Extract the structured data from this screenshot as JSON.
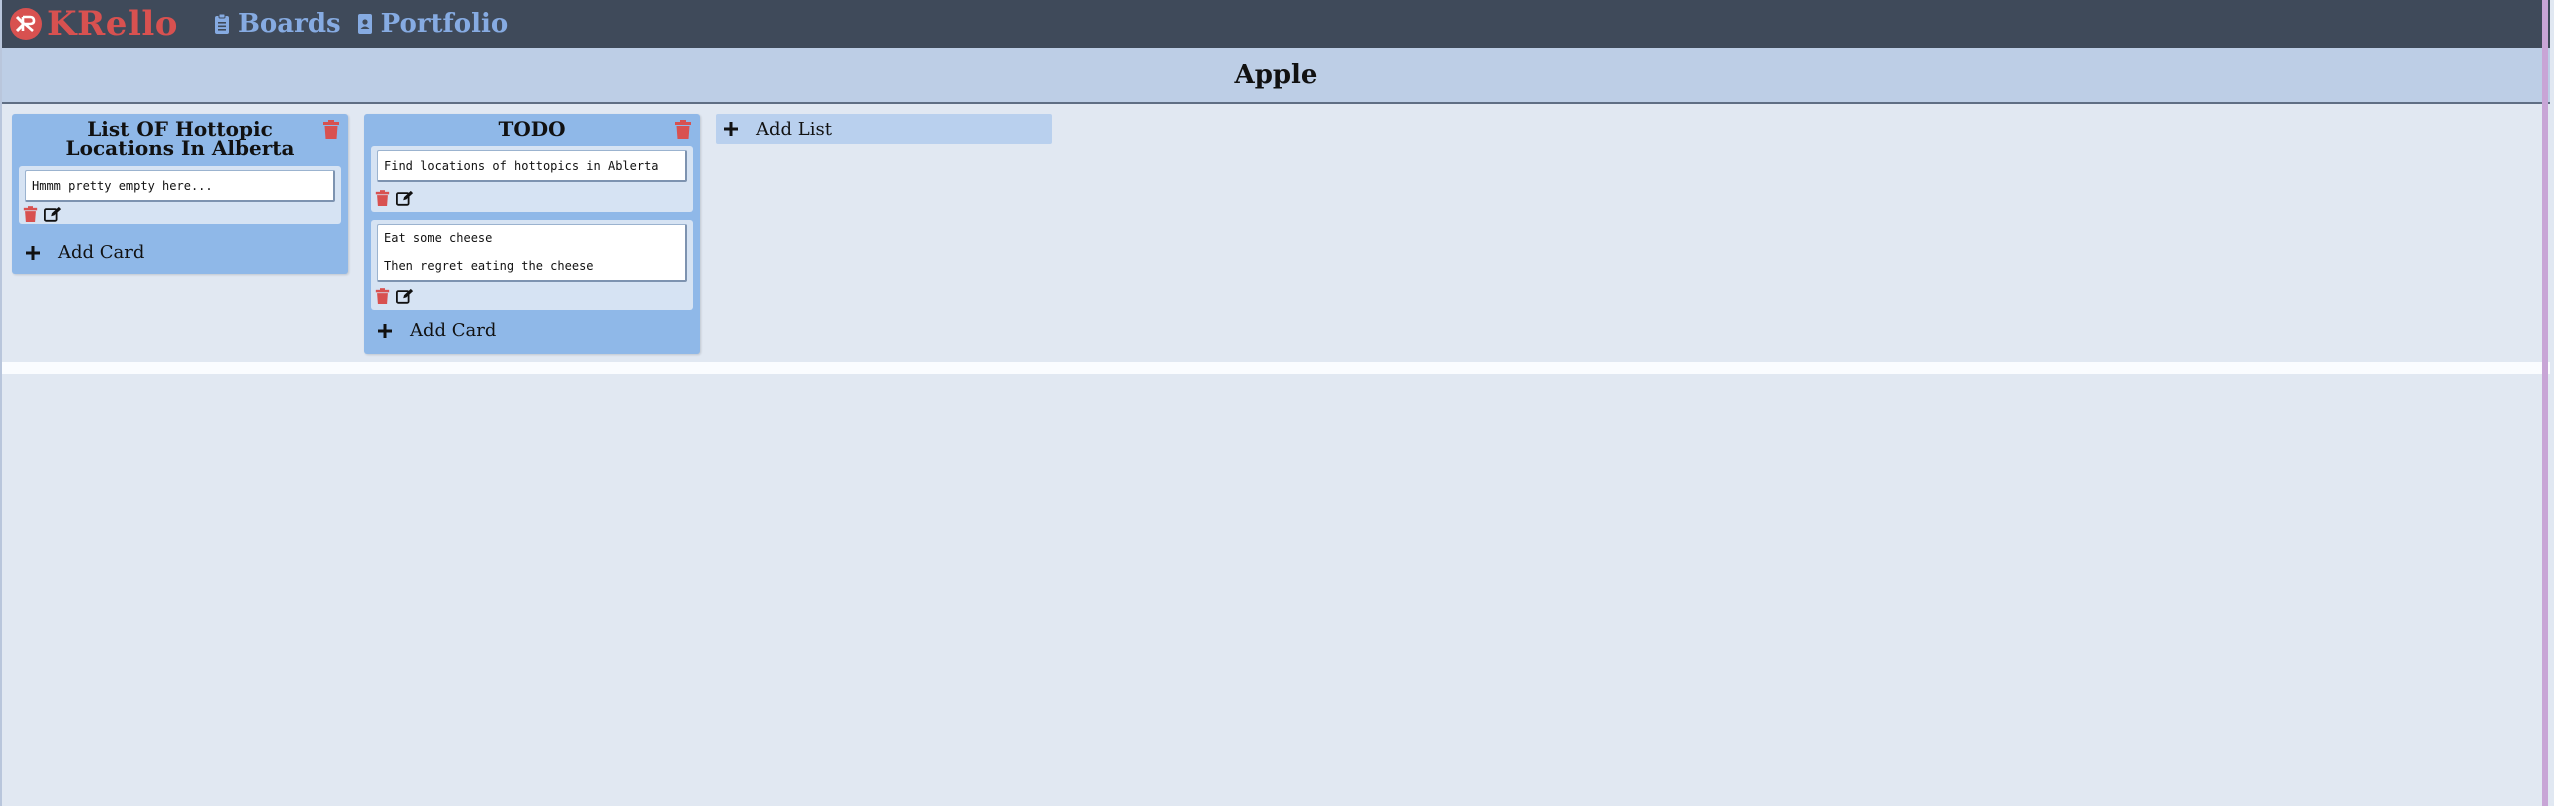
{
  "app": {
    "name": "KRello",
    "logo_text": "KR",
    "nav": [
      {
        "label": "Boards",
        "icon": "clipboard-icon"
      },
      {
        "label": "Portfolio",
        "icon": "portfolio-icon"
      }
    ]
  },
  "board": {
    "title": "Apple",
    "add_list_label": "Add List",
    "lists": [
      {
        "title": "List OF Hottopic Locations In Alberta",
        "cards": [
          {
            "text": "Hmmm pretty empty here..."
          }
        ],
        "add_card_label": "Add Card"
      },
      {
        "title": "TODO",
        "cards": [
          {
            "text": "Find locations of hottopics in Ablerta"
          },
          {
            "text": "Eat some cheese\n\nThen regret eating the cheese"
          }
        ],
        "add_card_label": "Add Card"
      }
    ]
  },
  "colors": {
    "navbar": "#3f4a5a",
    "brand": "#d85150",
    "nav_link": "#86abe2",
    "board_header": "#bdcee6",
    "list": "#8fb8e8",
    "delete_icon": "#d85150"
  }
}
